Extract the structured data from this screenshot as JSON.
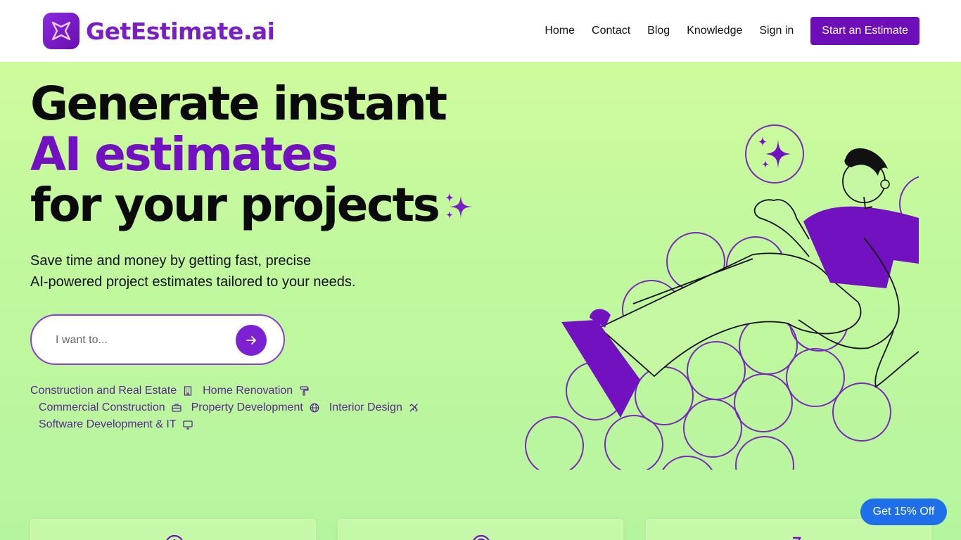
{
  "brand": {
    "name": "GetEstimate.ai",
    "accent": "#6e0eb8"
  },
  "nav": {
    "links": [
      "Home",
      "Contact",
      "Blog",
      "Knowledge",
      "Sign in"
    ],
    "cta": "Start an Estimate"
  },
  "hero": {
    "line1": "Generate instant",
    "line2": "AI estimates",
    "line3": "for your projects",
    "subtitle_line1": "Save time and money by getting fast, precise",
    "subtitle_line2": "AI-powered project estimates tailored to your needs."
  },
  "search": {
    "placeholder": "I want to..."
  },
  "categories": [
    {
      "label": "Construction and Real Estate",
      "icon": "building-icon"
    },
    {
      "label": "Home Renovation",
      "icon": "paint-roller-icon"
    },
    {
      "label": "Commercial Construction",
      "icon": "briefcase-icon"
    },
    {
      "label": "Property Development",
      "icon": "globe-icon"
    },
    {
      "label": "Interior Design",
      "icon": "ruler-pencil-icon"
    },
    {
      "label": "Software Development & IT",
      "icon": "monitor-icon"
    }
  ],
  "promo": {
    "label": "Get 15% Off",
    "color": "#1e6fe8"
  }
}
